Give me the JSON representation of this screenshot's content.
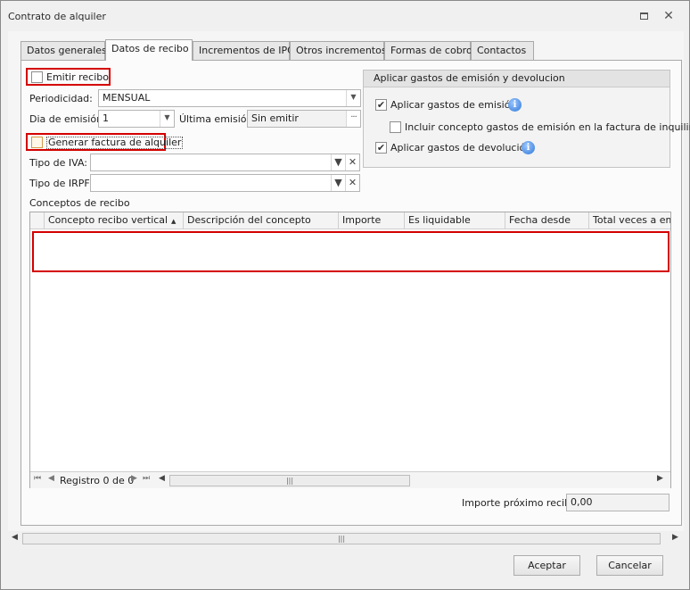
{
  "window": {
    "title": "Contrato de alquiler"
  },
  "tabs": [
    "Datos generales",
    "Datos de recibo",
    "Incrementos de IPC",
    "Otros incrementos",
    "Formas de cobro",
    "Contactos"
  ],
  "active_tab": "Datos de recibo",
  "form": {
    "emitir_recibo_label": "Emitir recibo",
    "periodicidad_label": "Periodicidad:",
    "periodicidad_value": "MENSUAL",
    "dia_emision_label": "Dia de emisión:",
    "dia_emision_value": "1",
    "ultima_emision_label": "Última emisión:",
    "ultima_emision_value": "Sin emitir",
    "generar_factura_label": "Generar factura de alquiler",
    "tipo_iva_label": "Tipo de IVA:",
    "tipo_iva_value": "",
    "tipo_irpf_label": "Tipo de IRPF:",
    "tipo_irpf_value": "",
    "conceptos_label": "Conceptos de recibo"
  },
  "gastos": {
    "title": "Aplicar gastos de emisión y devolucion",
    "aplicar_emision_label": "Aplicar gastos de emisión",
    "aplicar_emision_checked": true,
    "incluir_concepto_label": "Incluir concepto gastos de emisión en la factura de inquilino",
    "incluir_concepto_checked": false,
    "aplicar_devolucion_label": "Aplicar gastos de devolución",
    "aplicar_devolucion_checked": true
  },
  "grid": {
    "columns": [
      "Concepto recibo vertical",
      "Descripción del concepto",
      "Importe",
      "Es liquidable",
      "Fecha desde",
      "Total veces a emit"
    ],
    "record_text": "Registro 0 de 0"
  },
  "footer": {
    "importe_label": "Importe próximo recibo",
    "importe_value": "0,00",
    "accept_label": "Aceptar",
    "cancel_label": "Cancelar"
  },
  "icons": {
    "check_mark": "✔",
    "dropdown": "▼",
    "clear": "✕",
    "ellipsis": "···",
    "info": "i",
    "close": "✕"
  }
}
